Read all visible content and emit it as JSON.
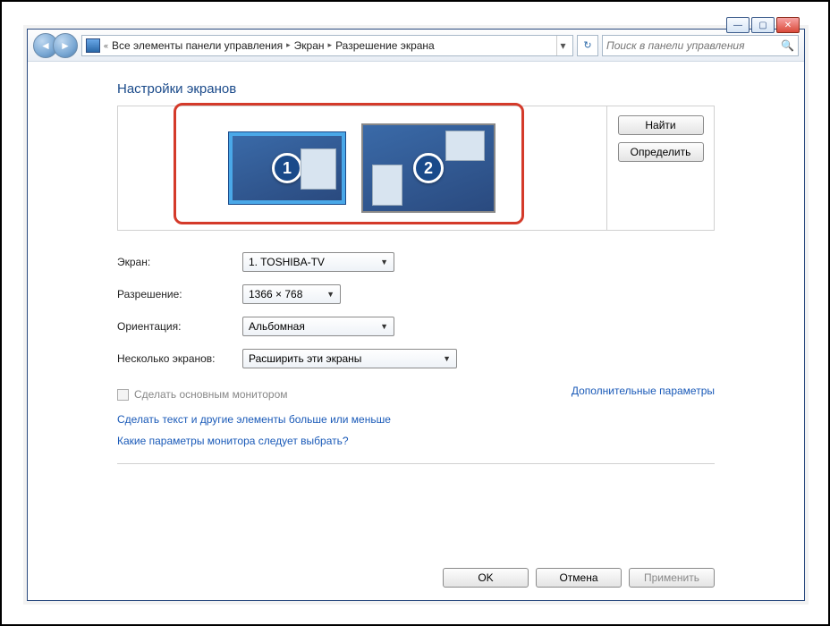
{
  "window_controls": {
    "minimize": "—",
    "maximize": "▢",
    "close": "✕"
  },
  "breadcrumb": {
    "prefix": "«",
    "items": [
      "Все элементы панели управления",
      "Экран",
      "Разрешение экрана"
    ]
  },
  "search": {
    "placeholder": "Поиск в панели управления"
  },
  "title": "Настройки экранов",
  "monitors": {
    "m1_number": "1",
    "m2_number": "2"
  },
  "side_buttons": {
    "find": "Найти",
    "detect": "Определить"
  },
  "settings": {
    "screen": {
      "label": "Экран:",
      "value": "1. TOSHIBA-TV"
    },
    "resolution": {
      "label": "Разрешение:",
      "value": "1366 × 768"
    },
    "orientation": {
      "label": "Ориентация:",
      "value": "Альбомная"
    },
    "multi": {
      "label": "Несколько экранов:",
      "value": "Расширить эти экраны"
    }
  },
  "make_primary": "Сделать основным монитором",
  "advanced_link": "Дополнительные параметры",
  "links": {
    "text_size": "Сделать текст и другие элементы больше или меньше",
    "which_params": "Какие параметры монитора следует выбрать?"
  },
  "footer": {
    "ok": "OK",
    "cancel": "Отмена",
    "apply": "Применить"
  }
}
